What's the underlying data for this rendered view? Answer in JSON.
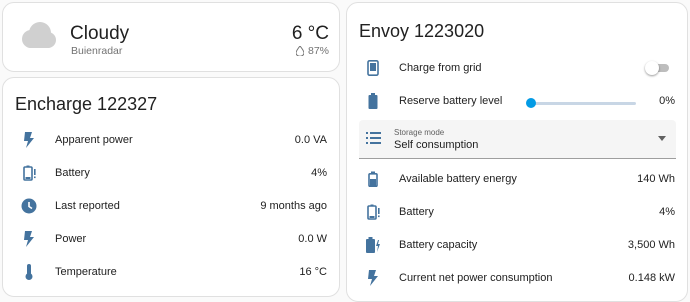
{
  "weather": {
    "condition": "Cloudy",
    "source": "Buienradar",
    "temperature": "6 °C",
    "humidity": "87%"
  },
  "encharge": {
    "title": "Encharge 122327",
    "rows": [
      {
        "label": "Apparent power",
        "value": "0.0 VA",
        "icon": "lightning-bolt-icon"
      },
      {
        "label": "Battery",
        "value": "4%",
        "icon": "battery-alert-icon"
      },
      {
        "label": "Last reported",
        "value": "9 months ago",
        "icon": "clock-icon"
      },
      {
        "label": "Power",
        "value": "0.0 W",
        "icon": "lightning-bolt-icon"
      },
      {
        "label": "Temperature",
        "value": "16 °C",
        "icon": "thermometer-icon"
      }
    ]
  },
  "envoy": {
    "title": "Envoy 1223020",
    "charge_from_grid": {
      "label": "Charge from grid",
      "on": false
    },
    "reserve_battery": {
      "label": "Reserve battery level",
      "value": "0%",
      "level": 0
    },
    "storage_mode": {
      "label": "Storage mode",
      "value": "Self consumption"
    },
    "rows": [
      {
        "label": "Available battery energy",
        "value": "140 Wh",
        "icon": "battery-medium-icon"
      },
      {
        "label": "Battery",
        "value": "4%",
        "icon": "battery-alert-icon"
      },
      {
        "label": "Battery capacity",
        "value": "3,500 Wh",
        "icon": "battery-charging-icon"
      },
      {
        "label": "Current net power consumption",
        "value": "0.148 kW",
        "icon": "lightning-bolt-icon"
      }
    ]
  },
  "colors": {
    "icon": "#44739e",
    "accent": "#039be5"
  }
}
